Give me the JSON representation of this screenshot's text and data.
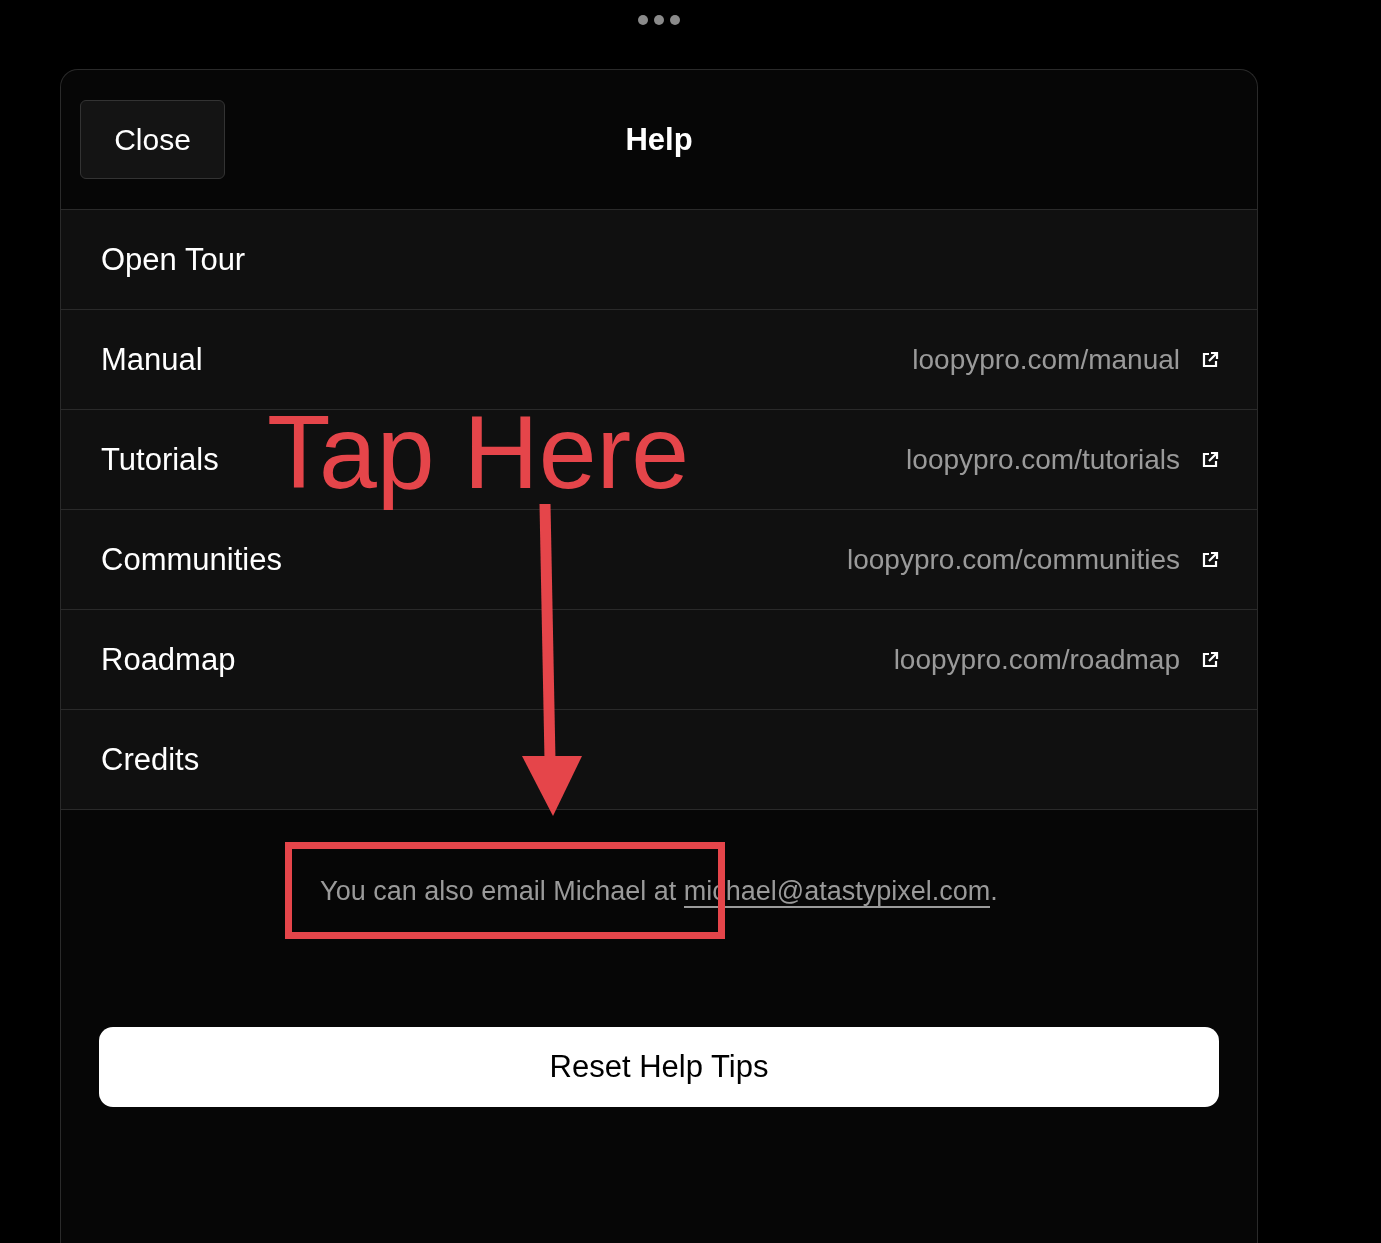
{
  "header": {
    "close_button": "Close",
    "title": "Help"
  },
  "rows": [
    {
      "label": "Open Tour"
    },
    {
      "label": "Manual",
      "link": "loopypro.com/manual"
    },
    {
      "label": "Tutorials",
      "link": "loopypro.com/tutorials",
      "annotation": "Tap Here"
    },
    {
      "label": "Communities",
      "link": "loopypro.com/communities"
    },
    {
      "label": "Roadmap",
      "link": "loopypro.com/roadmap"
    },
    {
      "label": "Credits"
    }
  ],
  "email_note": {
    "text": "You can also email Michael at ",
    "link": "michael@atastypixel.com",
    "end": "."
  },
  "reset_button": "Reset Help Tips"
}
